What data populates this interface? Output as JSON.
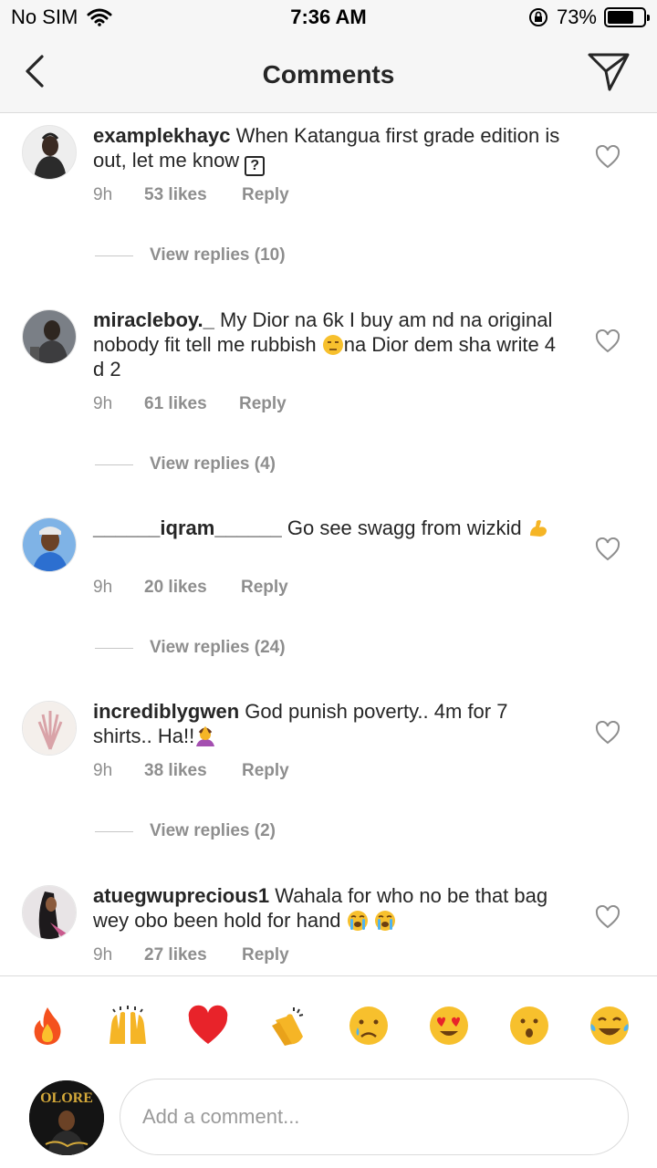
{
  "status_bar": {
    "carrier": "No SIM",
    "time": "7:36 AM",
    "battery_percent": "73%",
    "battery_level": 0.73
  },
  "nav": {
    "title": "Comments"
  },
  "comments": [
    {
      "username": "examplekhayc",
      "text": "When Katangua first grade edition is out, let me know ",
      "time": "9h",
      "likes": "53 likes",
      "reply": "Reply",
      "view_replies": "View replies (10)"
    },
    {
      "username": "miracleboy._",
      "text": "My Dior na 6k I buy am nd na original nobody fit tell me rubbish ",
      "text_after": "na Dior dem sha write 4 d 2",
      "time": "9h",
      "likes": "61 likes",
      "reply": "Reply",
      "view_replies": "View replies (4)"
    },
    {
      "username": "______iqram______",
      "text": "Go see swagg from wizkid ",
      "time": "9h",
      "likes": "20 likes",
      "reply": "Reply",
      "view_replies": "View replies (24)"
    },
    {
      "username": "incrediblygwen",
      "text": "God punish poverty.. 4m for 7 shirts.. Ha!!",
      "time": "9h",
      "likes": "38 likes",
      "reply": "Reply",
      "view_replies": "View replies (2)"
    },
    {
      "username": "atuegwuprecious1",
      "text": "Wahala for who no be that bag wey obo been hold for hand ",
      "time": "9h",
      "likes": "27 likes",
      "reply": "Reply"
    }
  ],
  "emoji_bar": [
    "fire",
    "raised-hands",
    "red-heart",
    "clapping-hands",
    "crying-face",
    "heart-eyes",
    "astonished-face",
    "tears-of-joy"
  ],
  "composer": {
    "placeholder": "Add a comment...",
    "avatar_text": "OLORE"
  },
  "colors": {
    "primary_text": "#262626",
    "secondary_text": "#8e8e8e",
    "divider": "#dbdbdb",
    "bar_background": "#f6f6f6"
  }
}
